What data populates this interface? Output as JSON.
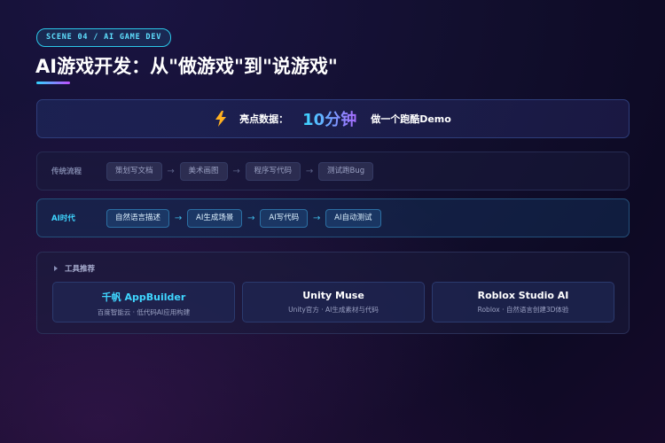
{
  "scene_tag": "SCENE 04 / AI GAME DEV",
  "title": "AI游戏开发：从\"做游戏\"到\"说游戏\"",
  "highlight": {
    "icon": "lightning-bolt-icon",
    "label": "亮点数据：",
    "value": "10分钟",
    "description": "做一个跑酷Demo"
  },
  "traditional_flow": {
    "label": "传统流程",
    "steps": [
      "策划写文档",
      "美术画图",
      "程序写代码",
      "测试跑Bug"
    ],
    "arrow": "→"
  },
  "ai_flow": {
    "label": "AI时代",
    "steps": [
      "自然语言描述",
      "AI生成场景",
      "AI写代码",
      "AI自动测试"
    ],
    "arrow": "→"
  },
  "tools": {
    "header": "工具推荐",
    "items": [
      {
        "name": "千帆 AppBuilder",
        "description": "百度智能云 · 低代码AI应用构建"
      },
      {
        "name": "Unity Muse",
        "description": "Unity官方 · AI生成素材与代码"
      },
      {
        "name": "Roblox Studio AI",
        "description": "Roblox · 自然语言创建3D体验"
      }
    ]
  },
  "colors": {
    "accent_cyan": "#3fd6ff",
    "accent_purple": "#a86cff",
    "background": "#120f2e"
  }
}
